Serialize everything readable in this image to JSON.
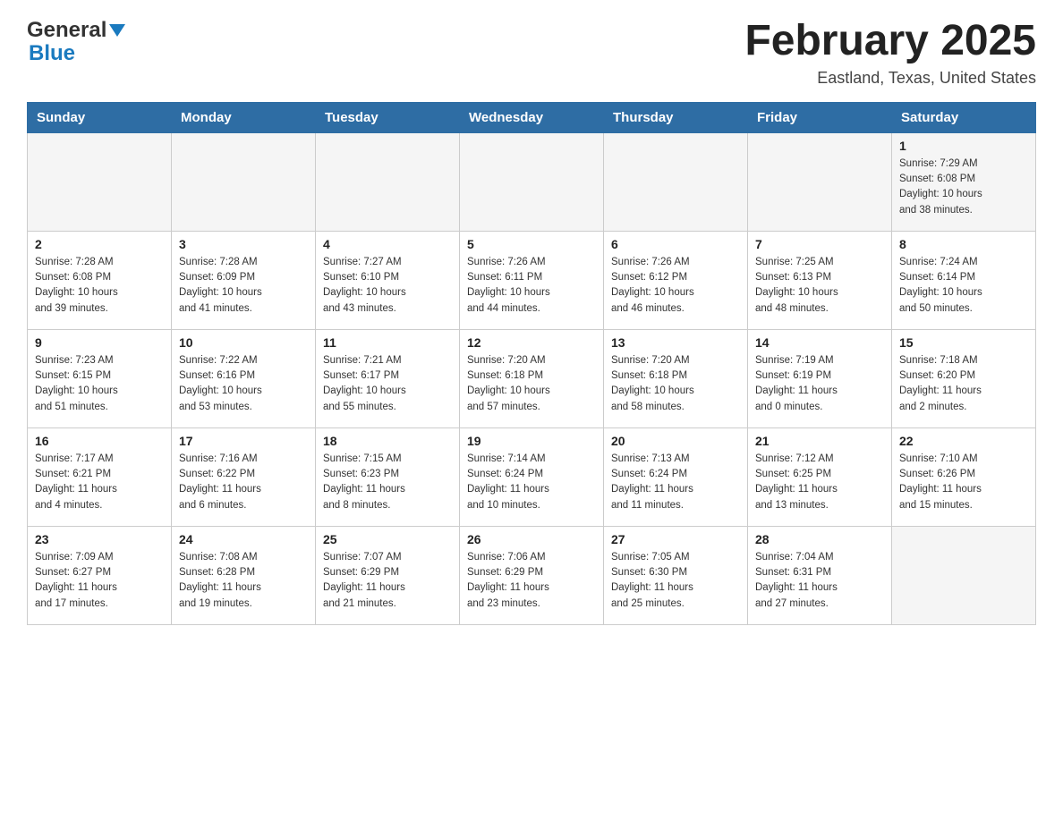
{
  "logo": {
    "general": "General",
    "blue": "Blue"
  },
  "title": "February 2025",
  "location": "Eastland, Texas, United States",
  "days_of_week": [
    "Sunday",
    "Monday",
    "Tuesday",
    "Wednesday",
    "Thursday",
    "Friday",
    "Saturday"
  ],
  "weeks": [
    [
      {
        "day": "",
        "info": ""
      },
      {
        "day": "",
        "info": ""
      },
      {
        "day": "",
        "info": ""
      },
      {
        "day": "",
        "info": ""
      },
      {
        "day": "",
        "info": ""
      },
      {
        "day": "",
        "info": ""
      },
      {
        "day": "1",
        "info": "Sunrise: 7:29 AM\nSunset: 6:08 PM\nDaylight: 10 hours\nand 38 minutes."
      }
    ],
    [
      {
        "day": "2",
        "info": "Sunrise: 7:28 AM\nSunset: 6:08 PM\nDaylight: 10 hours\nand 39 minutes."
      },
      {
        "day": "3",
        "info": "Sunrise: 7:28 AM\nSunset: 6:09 PM\nDaylight: 10 hours\nand 41 minutes."
      },
      {
        "day": "4",
        "info": "Sunrise: 7:27 AM\nSunset: 6:10 PM\nDaylight: 10 hours\nand 43 minutes."
      },
      {
        "day": "5",
        "info": "Sunrise: 7:26 AM\nSunset: 6:11 PM\nDaylight: 10 hours\nand 44 minutes."
      },
      {
        "day": "6",
        "info": "Sunrise: 7:26 AM\nSunset: 6:12 PM\nDaylight: 10 hours\nand 46 minutes."
      },
      {
        "day": "7",
        "info": "Sunrise: 7:25 AM\nSunset: 6:13 PM\nDaylight: 10 hours\nand 48 minutes."
      },
      {
        "day": "8",
        "info": "Sunrise: 7:24 AM\nSunset: 6:14 PM\nDaylight: 10 hours\nand 50 minutes."
      }
    ],
    [
      {
        "day": "9",
        "info": "Sunrise: 7:23 AM\nSunset: 6:15 PM\nDaylight: 10 hours\nand 51 minutes."
      },
      {
        "day": "10",
        "info": "Sunrise: 7:22 AM\nSunset: 6:16 PM\nDaylight: 10 hours\nand 53 minutes."
      },
      {
        "day": "11",
        "info": "Sunrise: 7:21 AM\nSunset: 6:17 PM\nDaylight: 10 hours\nand 55 minutes."
      },
      {
        "day": "12",
        "info": "Sunrise: 7:20 AM\nSunset: 6:18 PM\nDaylight: 10 hours\nand 57 minutes."
      },
      {
        "day": "13",
        "info": "Sunrise: 7:20 AM\nSunset: 6:18 PM\nDaylight: 10 hours\nand 58 minutes."
      },
      {
        "day": "14",
        "info": "Sunrise: 7:19 AM\nSunset: 6:19 PM\nDaylight: 11 hours\nand 0 minutes."
      },
      {
        "day": "15",
        "info": "Sunrise: 7:18 AM\nSunset: 6:20 PM\nDaylight: 11 hours\nand 2 minutes."
      }
    ],
    [
      {
        "day": "16",
        "info": "Sunrise: 7:17 AM\nSunset: 6:21 PM\nDaylight: 11 hours\nand 4 minutes."
      },
      {
        "day": "17",
        "info": "Sunrise: 7:16 AM\nSunset: 6:22 PM\nDaylight: 11 hours\nand 6 minutes."
      },
      {
        "day": "18",
        "info": "Sunrise: 7:15 AM\nSunset: 6:23 PM\nDaylight: 11 hours\nand 8 minutes."
      },
      {
        "day": "19",
        "info": "Sunrise: 7:14 AM\nSunset: 6:24 PM\nDaylight: 11 hours\nand 10 minutes."
      },
      {
        "day": "20",
        "info": "Sunrise: 7:13 AM\nSunset: 6:24 PM\nDaylight: 11 hours\nand 11 minutes."
      },
      {
        "day": "21",
        "info": "Sunrise: 7:12 AM\nSunset: 6:25 PM\nDaylight: 11 hours\nand 13 minutes."
      },
      {
        "day": "22",
        "info": "Sunrise: 7:10 AM\nSunset: 6:26 PM\nDaylight: 11 hours\nand 15 minutes."
      }
    ],
    [
      {
        "day": "23",
        "info": "Sunrise: 7:09 AM\nSunset: 6:27 PM\nDaylight: 11 hours\nand 17 minutes."
      },
      {
        "day": "24",
        "info": "Sunrise: 7:08 AM\nSunset: 6:28 PM\nDaylight: 11 hours\nand 19 minutes."
      },
      {
        "day": "25",
        "info": "Sunrise: 7:07 AM\nSunset: 6:29 PM\nDaylight: 11 hours\nand 21 minutes."
      },
      {
        "day": "26",
        "info": "Sunrise: 7:06 AM\nSunset: 6:29 PM\nDaylight: 11 hours\nand 23 minutes."
      },
      {
        "day": "27",
        "info": "Sunrise: 7:05 AM\nSunset: 6:30 PM\nDaylight: 11 hours\nand 25 minutes."
      },
      {
        "day": "28",
        "info": "Sunrise: 7:04 AM\nSunset: 6:31 PM\nDaylight: 11 hours\nand 27 minutes."
      },
      {
        "day": "",
        "info": ""
      }
    ]
  ]
}
